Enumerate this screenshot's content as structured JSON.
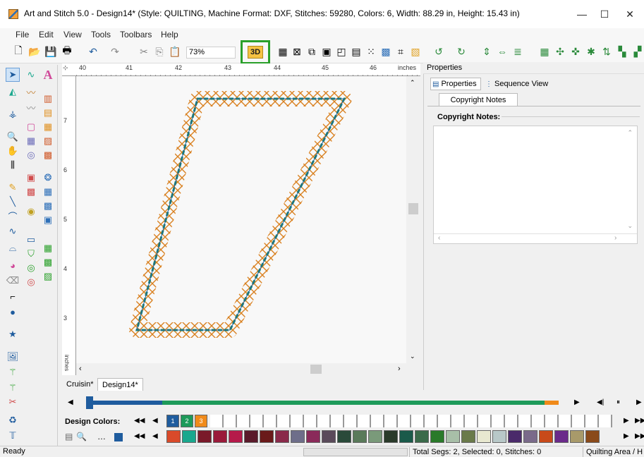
{
  "window": {
    "title": "Art and Stitch 5.0 - Design14* (Style: QUILTING, Machine Format: DXF, Stitches: 59280, Colors: 6, Width: 88.29 in, Height: 15.43 in)",
    "minimize": "—",
    "maximize": "☐",
    "close": "✕"
  },
  "menu": [
    "File",
    "Edit",
    "View",
    "Tools",
    "Toolbars",
    "Help"
  ],
  "toolbar": {
    "zoom": "73%",
    "btn3d": "3D"
  },
  "ruler": {
    "h_labels": [
      "40",
      "41",
      "42",
      "43",
      "44",
      "45",
      "46"
    ],
    "h_unit": "inches",
    "v_labels": [
      "7",
      "6",
      "5",
      "4",
      "3"
    ],
    "v_unit": "inches"
  },
  "tabs": [
    "Cruisin*",
    "Design14*"
  ],
  "properties": {
    "title": "Properties",
    "tab_properties": "Properties",
    "tab_sequence": "Sequence View",
    "subtab": "Copyright Notes",
    "group_label": "Copyright Notes:"
  },
  "colors": {
    "label": "Design Colors:",
    "design_swatches": [
      {
        "num": "1",
        "color": "#1f5c9e"
      },
      {
        "num": "2",
        "color": "#1e9a5a"
      },
      {
        "num": "3",
        "color": "#f08a1a"
      }
    ],
    "palette": [
      "#d94a2a",
      "#1aa88e",
      "#7a1a2a",
      "#9a1a3a",
      "#b51a4a",
      "#5a1a2a",
      "#6a1a1a",
      "#8a2a4a",
      "#6e6e8a",
      "#8a2a5a",
      "#5a4a5a",
      "#2a4a3a",
      "#5a7a5a",
      "#7a9a7a",
      "#2a3a2a",
      "#1a5a4a",
      "#3a6a4a",
      "#2a7a2a",
      "#a8bfa8",
      "#6a7a4a",
      "#e8e8d0",
      "#b8c8c8",
      "#4a2a6a",
      "#7a6a8a",
      "#c84a1a",
      "#6a2a8a",
      "#a89a6a",
      "#8a4a1a"
    ]
  },
  "status": {
    "ready": "Ready",
    "segs": "Total Segs: 2, Selected: 0, Stitches: 0",
    "area": "Quilting Area / H"
  },
  "accent": {
    "highlight": "#2aa02a",
    "progress_blue": "#1f5c9e",
    "progress_green": "#1e9a5a",
    "progress_orange": "#f08a1a"
  }
}
